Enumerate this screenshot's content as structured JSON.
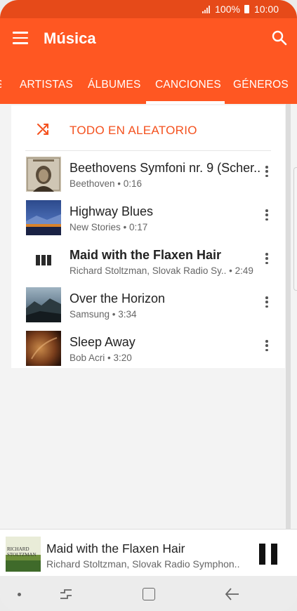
{
  "status_bar": {
    "battery": "100%",
    "time": "10:00"
  },
  "app_bar": {
    "title": "Música"
  },
  "tabs": [
    {
      "label": "ARTISTAS",
      "active": false
    },
    {
      "label": "ÁLBUMES",
      "active": false
    },
    {
      "label": "CANCIONES",
      "active": true
    },
    {
      "label": "GÉNEROS",
      "active": false
    }
  ],
  "shuffle": {
    "label": "TODO EN ALEATORIO",
    "icon": "shuffle-icon"
  },
  "songs": [
    {
      "title": "Beethovens Symfoni nr. 9 (Scher..",
      "subtitle": "Beethoven • 0:16",
      "playing": false
    },
    {
      "title": "Highway Blues",
      "subtitle": "New Stories • 0:17",
      "playing": false
    },
    {
      "title": "Maid with the Flaxen Hair",
      "subtitle": "Richard Stoltzman, Slovak Radio Sy.. • 2:49",
      "playing": true
    },
    {
      "title": "Over the Horizon",
      "subtitle": "Samsung • 3:34",
      "playing": false
    },
    {
      "title": "Sleep Away",
      "subtitle": "Bob Acri • 3:20",
      "playing": false
    }
  ],
  "player": {
    "title": "Maid with the Flaxen Hair",
    "subtitle": "Richard Stoltzman, Slovak Radio Symphon..",
    "art_text_line1": "RICHARD",
    "art_text_line2": "STOLTZMAN"
  },
  "colors": {
    "accent": "#ff5722",
    "status_bar": "#e64a19",
    "shuffle_text": "#f4511e"
  }
}
